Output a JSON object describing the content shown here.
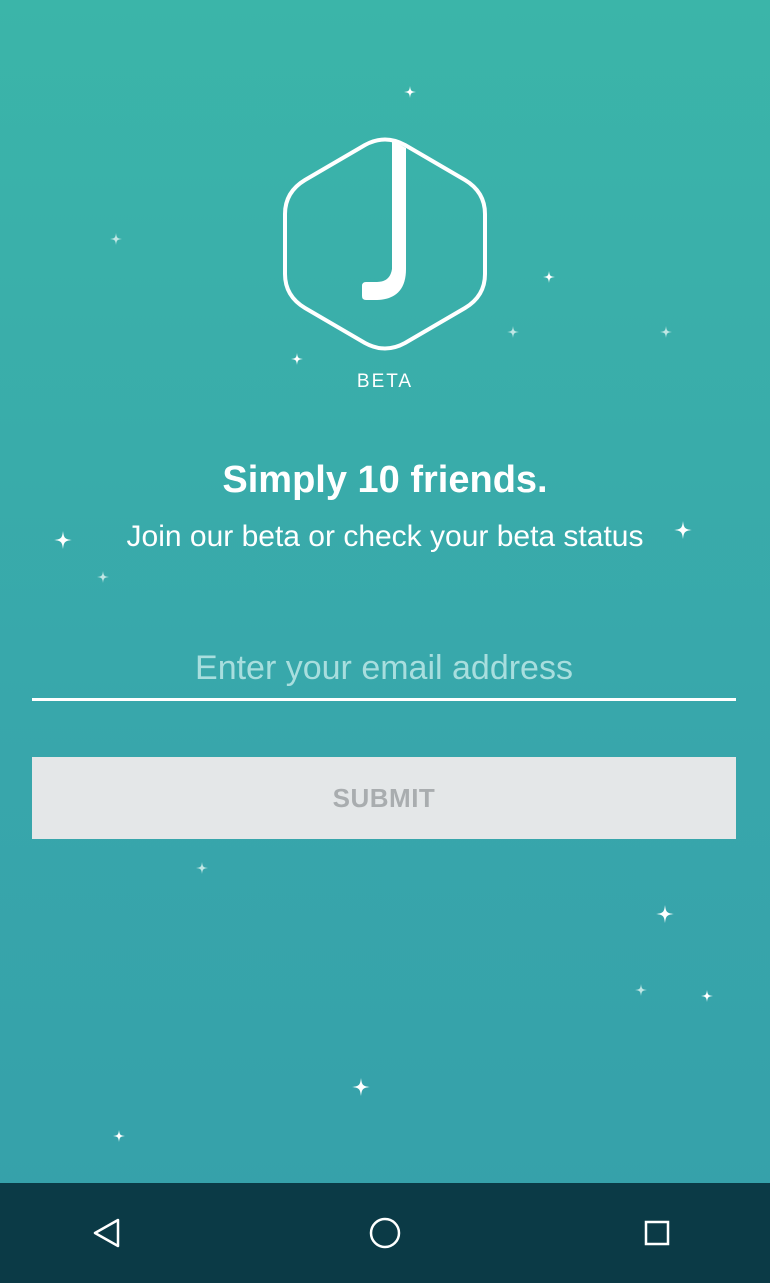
{
  "app": {
    "logo_letter": "J",
    "beta_label": "BETA"
  },
  "content": {
    "headline": "Simply 10 friends.",
    "subhead": "Join our beta or check your beta status"
  },
  "form": {
    "email_placeholder": "Enter your email address",
    "email_value": "",
    "submit_label": "SUBMIT"
  },
  "navbar": {
    "back_icon": "back-triangle-icon",
    "home_icon": "home-circle-icon",
    "recents_icon": "recents-square-icon"
  },
  "colors": {
    "background_top": "#3bb5a9",
    "background_bottom": "#35a0aa",
    "button_bg": "#e4e7e8",
    "button_text": "#a9adaf",
    "navbar_bg": "#0b3a46"
  }
}
